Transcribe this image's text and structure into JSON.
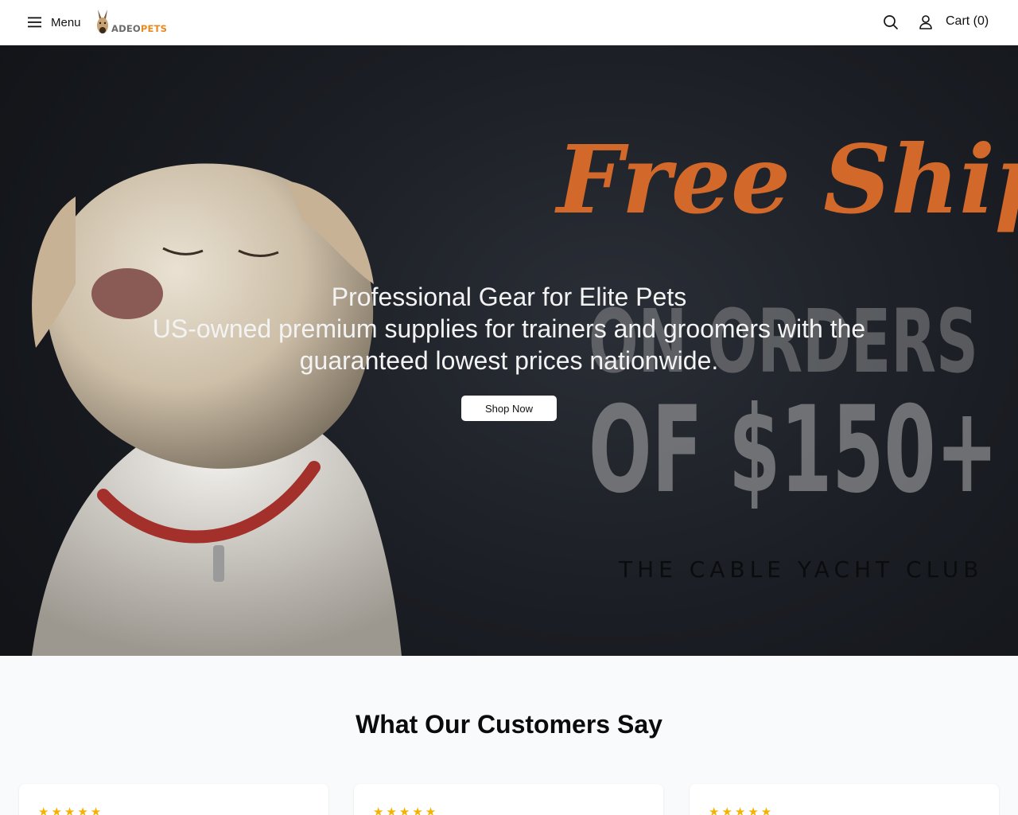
{
  "header": {
    "menu_label": "Menu",
    "logo_prefix": "ADEO",
    "logo_suffix": "PETS",
    "cart_label": "Cart (0)"
  },
  "hero": {
    "title": "Professional Gear for Elite Pets",
    "subtitle": "US-owned premium supplies for trainers and groomers with the guaranteed lowest prices nationwide.",
    "cta_label": "Shop Now",
    "banner_script": "Free Shipping",
    "banner_line1": "ON ORDERS",
    "banner_line2": "OF $150+",
    "banner_watermark": "THE CABLE YACHT CLUB"
  },
  "reviews": {
    "title": "What Our Customers Say",
    "cards": [
      {
        "stars": "★★★★★"
      },
      {
        "stars": "★★★★★"
      },
      {
        "stars": "★★★★★"
      }
    ]
  },
  "colors": {
    "accent_orange": "#d9742a",
    "star_gold": "#f5b301",
    "hero_dark": "#1a1d23"
  }
}
